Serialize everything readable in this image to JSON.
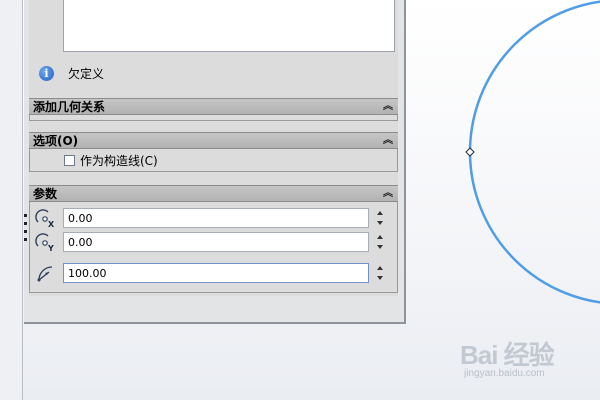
{
  "message": {
    "info_text": "欠定义"
  },
  "sections": {
    "relations": {
      "title": "添加几何关系"
    },
    "options": {
      "title": "选项(O)",
      "construction_label": "作为构造线(C)",
      "construction_checked": false
    },
    "parameters": {
      "title": "参数",
      "center_x": "0.00",
      "center_y": "0.00",
      "radius": "100.00"
    }
  },
  "icons": {
    "info": "info-icon",
    "collapse": "double-chevron-up-icon",
    "center_x": "circle-center-x-icon",
    "center_y": "circle-center-y-icon",
    "radius": "radius-icon"
  },
  "colors": {
    "circle": "#4f9de8",
    "header": "#bdbdbd",
    "info": "#2c6fd1"
  },
  "watermark": {
    "brand": "Bai 经验",
    "url": "jingyan.baidu.com"
  }
}
